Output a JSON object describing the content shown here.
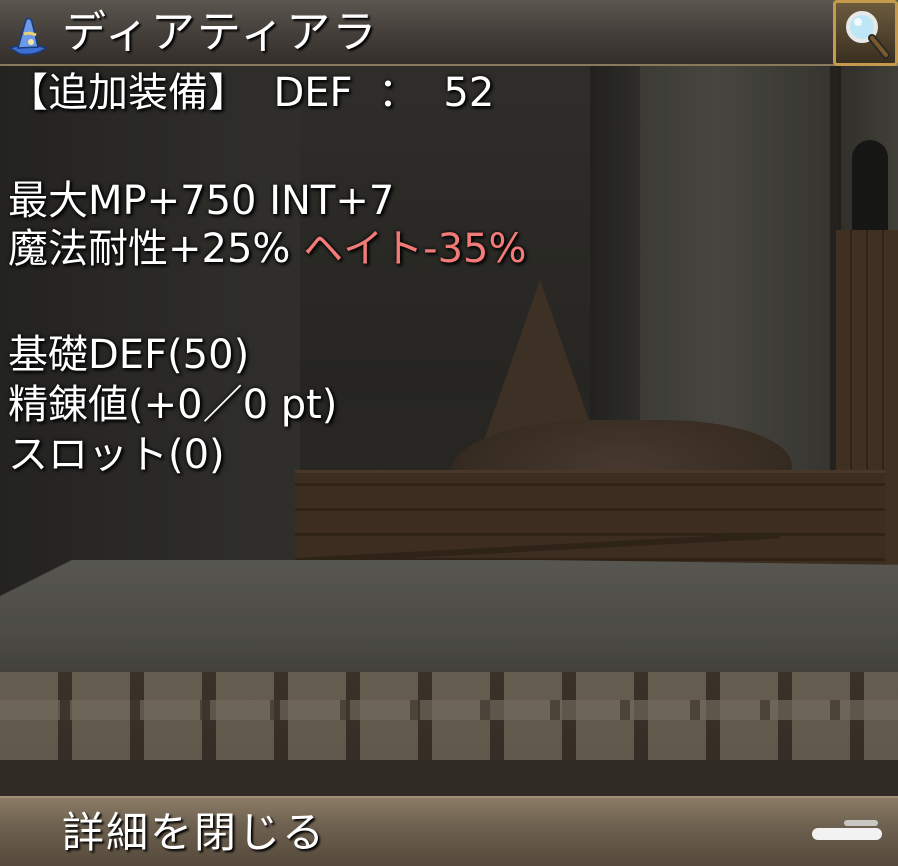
{
  "header": {
    "item_name": "ディアティアラ",
    "item_icon": "wizard-hat-icon",
    "zoom_icon": "magnifier-icon"
  },
  "stats": {
    "extra_label": "【追加装備】",
    "extra_stat": "DEF",
    "extra_sep": "：",
    "extra_value": "52",
    "line_mp_int": "最大MP+750 INT+7",
    "line_resist": "魔法耐性+25%",
    "line_hate": "ヘイト-35%",
    "line_base_def": "基礎DEF(50)",
    "line_refine": "精錬値(+0／0 pt)",
    "line_slot": "スロット(0)"
  },
  "footer": {
    "close_label": "詳細を閉じる"
  },
  "colors": {
    "text": "#ffffff",
    "negative_stat": "#f27a78",
    "frame_gold": "#c59a4a"
  }
}
